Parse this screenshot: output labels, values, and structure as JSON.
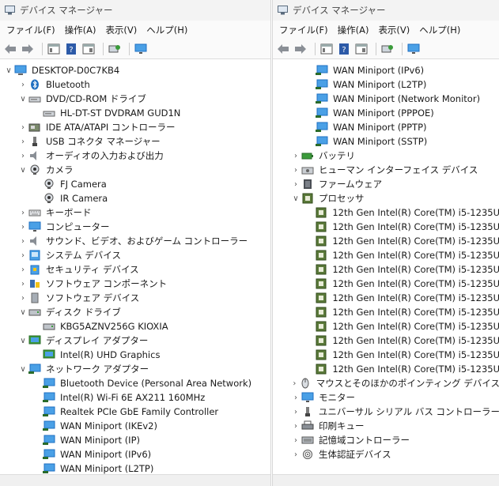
{
  "window": {
    "title": "デバイス マネージャー",
    "menu": [
      "ファイル(F)",
      "操作(A)",
      "表示(V)",
      "ヘルプ(H)"
    ]
  },
  "left_tree": [
    {
      "indent": 0,
      "chev": "down",
      "icon": "computer-icon",
      "label": "DESKTOP-D0C7KB4"
    },
    {
      "indent": 1,
      "chev": "right",
      "icon": "bluetooth-icon",
      "label": "Bluetooth"
    },
    {
      "indent": 1,
      "chev": "down",
      "icon": "dvd-drive-icon",
      "label": "DVD/CD-ROM ドライブ"
    },
    {
      "indent": 2,
      "chev": "",
      "icon": "dvd-drive-icon",
      "label": "HL-DT-ST DVDRAM GUD1N"
    },
    {
      "indent": 1,
      "chev": "right",
      "icon": "ide-controller-icon",
      "label": "IDE ATA/ATAPI コントローラー"
    },
    {
      "indent": 1,
      "chev": "right",
      "icon": "usb-connector-icon",
      "label": "USB コネクタ マネージャー"
    },
    {
      "indent": 1,
      "chev": "right",
      "icon": "speaker-icon",
      "label": "オーディオの入力および出力"
    },
    {
      "indent": 1,
      "chev": "down",
      "icon": "camera-icon",
      "label": "カメラ"
    },
    {
      "indent": 2,
      "chev": "",
      "icon": "camera-icon",
      "label": "FJ Camera"
    },
    {
      "indent": 2,
      "chev": "",
      "icon": "camera-icon",
      "label": "IR Camera"
    },
    {
      "indent": 1,
      "chev": "right",
      "icon": "keyboard-icon",
      "label": "キーボード"
    },
    {
      "indent": 1,
      "chev": "right",
      "icon": "monitor-icon",
      "label": "コンピューター"
    },
    {
      "indent": 1,
      "chev": "right",
      "icon": "speaker-icon",
      "label": "サウンド、ビデオ、およびゲーム コントローラー"
    },
    {
      "indent": 1,
      "chev": "right",
      "icon": "system-device-icon",
      "label": "システム デバイス"
    },
    {
      "indent": 1,
      "chev": "right",
      "icon": "security-device-icon",
      "label": "セキュリティ デバイス"
    },
    {
      "indent": 1,
      "chev": "right",
      "icon": "software-component-icon",
      "label": "ソフトウェア コンポーネント"
    },
    {
      "indent": 1,
      "chev": "right",
      "icon": "software-device-icon",
      "label": "ソフトウェア デバイス"
    },
    {
      "indent": 1,
      "chev": "down",
      "icon": "disk-drive-icon",
      "label": "ディスク ドライブ"
    },
    {
      "indent": 2,
      "chev": "",
      "icon": "disk-drive-icon",
      "label": "KBG5AZNV256G KIOXIA"
    },
    {
      "indent": 1,
      "chev": "down",
      "icon": "display-adapter-icon",
      "label": "ディスプレイ アダプター"
    },
    {
      "indent": 2,
      "chev": "",
      "icon": "display-adapter-icon",
      "label": "Intel(R) UHD Graphics"
    },
    {
      "indent": 1,
      "chev": "down",
      "icon": "network-adapter-icon",
      "label": "ネットワーク アダプター"
    },
    {
      "indent": 2,
      "chev": "",
      "icon": "network-adapter-icon",
      "label": "Bluetooth Device (Personal Area Network)"
    },
    {
      "indent": 2,
      "chev": "",
      "icon": "network-adapter-icon",
      "label": "Intel(R) Wi-Fi 6E AX211 160MHz"
    },
    {
      "indent": 2,
      "chev": "",
      "icon": "network-adapter-icon",
      "label": "Realtek PCIe GbE Family Controller"
    },
    {
      "indent": 2,
      "chev": "",
      "icon": "network-adapter-icon",
      "label": "WAN Miniport (IKEv2)"
    },
    {
      "indent": 2,
      "chev": "",
      "icon": "network-adapter-icon",
      "label": "WAN Miniport (IP)"
    },
    {
      "indent": 2,
      "chev": "",
      "icon": "network-adapter-icon",
      "label": "WAN Miniport (IPv6)"
    },
    {
      "indent": 2,
      "chev": "",
      "icon": "network-adapter-icon",
      "label": "WAN Miniport (L2TP)"
    }
  ],
  "right_tree": [
    {
      "indent": 2,
      "chev": "",
      "icon": "network-adapter-icon",
      "label": "WAN Miniport (IPv6)"
    },
    {
      "indent": 2,
      "chev": "",
      "icon": "network-adapter-icon",
      "label": "WAN Miniport (L2TP)"
    },
    {
      "indent": 2,
      "chev": "",
      "icon": "network-adapter-icon",
      "label": "WAN Miniport (Network Monitor)"
    },
    {
      "indent": 2,
      "chev": "",
      "icon": "network-adapter-icon",
      "label": "WAN Miniport (PPPOE)"
    },
    {
      "indent": 2,
      "chev": "",
      "icon": "network-adapter-icon",
      "label": "WAN Miniport (PPTP)"
    },
    {
      "indent": 2,
      "chev": "",
      "icon": "network-adapter-icon",
      "label": "WAN Miniport (SSTP)"
    },
    {
      "indent": 1,
      "chev": "right",
      "icon": "battery-icon",
      "label": "バッテリ"
    },
    {
      "indent": 1,
      "chev": "right",
      "icon": "hid-icon",
      "label": "ヒューマン インターフェイス デバイス"
    },
    {
      "indent": 1,
      "chev": "right",
      "icon": "firmware-icon",
      "label": "ファームウェア"
    },
    {
      "indent": 1,
      "chev": "down",
      "icon": "processor-icon",
      "label": "プロセッサ"
    },
    {
      "indent": 2,
      "chev": "",
      "icon": "processor-icon",
      "label": "12th Gen Intel(R) Core(TM) i5-1235U"
    },
    {
      "indent": 2,
      "chev": "",
      "icon": "processor-icon",
      "label": "12th Gen Intel(R) Core(TM) i5-1235U"
    },
    {
      "indent": 2,
      "chev": "",
      "icon": "processor-icon",
      "label": "12th Gen Intel(R) Core(TM) i5-1235U"
    },
    {
      "indent": 2,
      "chev": "",
      "icon": "processor-icon",
      "label": "12th Gen Intel(R) Core(TM) i5-1235U"
    },
    {
      "indent": 2,
      "chev": "",
      "icon": "processor-icon",
      "label": "12th Gen Intel(R) Core(TM) i5-1235U"
    },
    {
      "indent": 2,
      "chev": "",
      "icon": "processor-icon",
      "label": "12th Gen Intel(R) Core(TM) i5-1235U"
    },
    {
      "indent": 2,
      "chev": "",
      "icon": "processor-icon",
      "label": "12th Gen Intel(R) Core(TM) i5-1235U"
    },
    {
      "indent": 2,
      "chev": "",
      "icon": "processor-icon",
      "label": "12th Gen Intel(R) Core(TM) i5-1235U"
    },
    {
      "indent": 2,
      "chev": "",
      "icon": "processor-icon",
      "label": "12th Gen Intel(R) Core(TM) i5-1235U"
    },
    {
      "indent": 2,
      "chev": "",
      "icon": "processor-icon",
      "label": "12th Gen Intel(R) Core(TM) i5-1235U"
    },
    {
      "indent": 2,
      "chev": "",
      "icon": "processor-icon",
      "label": "12th Gen Intel(R) Core(TM) i5-1235U"
    },
    {
      "indent": 2,
      "chev": "",
      "icon": "processor-icon",
      "label": "12th Gen Intel(R) Core(TM) i5-1235U"
    },
    {
      "indent": 1,
      "chev": "right",
      "icon": "mouse-icon",
      "label": "マウスとそのほかのポインティング デバイス"
    },
    {
      "indent": 1,
      "chev": "right",
      "icon": "monitor-icon",
      "label": "モニター"
    },
    {
      "indent": 1,
      "chev": "right",
      "icon": "usb-connector-icon",
      "label": "ユニバーサル シリアル バス コントローラー"
    },
    {
      "indent": 1,
      "chev": "right",
      "icon": "print-queue-icon",
      "label": "印刷キュー"
    },
    {
      "indent": 1,
      "chev": "right",
      "icon": "storage-controller-icon",
      "label": "記憶域コントローラー"
    },
    {
      "indent": 1,
      "chev": "right",
      "icon": "biometric-icon",
      "label": "生体認証デバイス"
    }
  ],
  "colors": {
    "network": "#2f87d8",
    "processor": "#5b7a3a",
    "accent": "#1f6fc1"
  }
}
